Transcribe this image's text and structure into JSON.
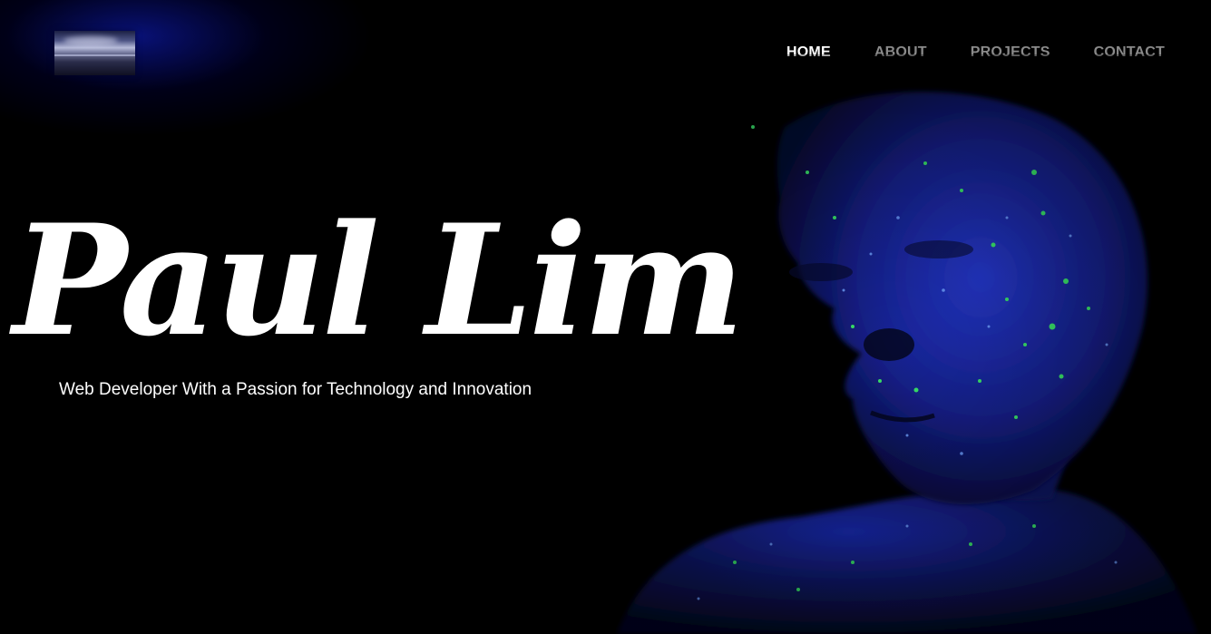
{
  "header": {
    "logo_icon": "landscape-thumbnail-icon"
  },
  "nav": {
    "items": [
      {
        "label": "HOME",
        "active": true
      },
      {
        "label": "ABOUT",
        "active": false
      },
      {
        "label": "PROJECTS",
        "active": false
      },
      {
        "label": "CONTACT",
        "active": false
      }
    ]
  },
  "hero": {
    "name": "Paul Lim",
    "tagline": "Web Developer With a Passion for Technology and Innovation",
    "image_icon": "glowing-face-portrait-icon"
  },
  "colors": {
    "background": "#000000",
    "nav_active": "#ffffff",
    "nav_inactive": "#8a8a8a",
    "accent_blue": "#1a2bd6",
    "accent_green": "#39e36a"
  }
}
